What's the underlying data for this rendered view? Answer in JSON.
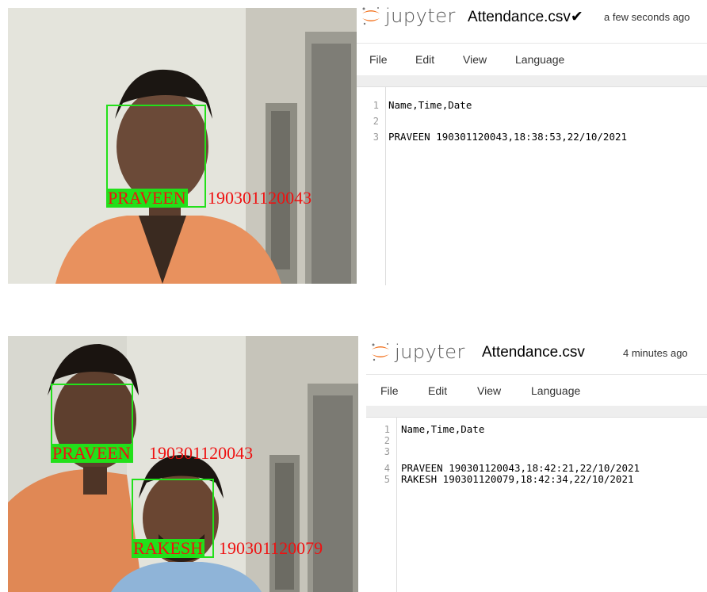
{
  "top": {
    "camera": {
      "box_label": "PRAVEEN",
      "box_id": "190301120043"
    },
    "jupyter": {
      "brand": "jupyter",
      "filename": "Attendance.csv",
      "checkmark": "✔",
      "saved_status": "a few seconds ago",
      "menu": [
        "File",
        "Edit",
        "View",
        "Language"
      ],
      "line_numbers": [
        "1",
        "2",
        "3"
      ],
      "lines": [
        "Name,Time,Date",
        "",
        "PRAVEEN 190301120043,18:38:53,22/10/2021"
      ]
    }
  },
  "bottom": {
    "camera": {
      "box1_label": "PRAVEEN",
      "box1_id": "190301120043",
      "box2_label": "RAKESH",
      "box2_id": "190301120079"
    },
    "jupyter": {
      "brand": "jupyter",
      "filename": "Attendance.csv",
      "saved_status": "4 minutes ago",
      "menu": [
        "File",
        "Edit",
        "View",
        "Language"
      ],
      "line_numbers": [
        "1",
        "2",
        "3",
        "4",
        "5"
      ],
      "lines": [
        "Name,Time,Date",
        "",
        "",
        "PRAVEEN 190301120043,18:42:21,22/10/2021",
        "RAKESH 190301120079,18:42:34,22/10/2021"
      ]
    }
  },
  "colors": {
    "box_green": "#22e01a",
    "label_red": "#ee1111",
    "jupyter_orange": "#f37726",
    "shirt_orange": "#e8915e"
  }
}
